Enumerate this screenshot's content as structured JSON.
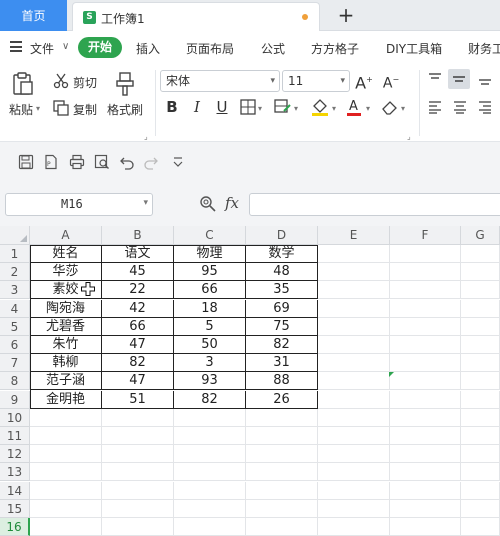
{
  "tabs": {
    "home_label": "首页",
    "doc_label": "工作簿1",
    "doc_icon_letter": "S",
    "add_icon": "plus-icon"
  },
  "menu": {
    "file_label": "文件",
    "items": [
      "开始",
      "插入",
      "页面布局",
      "公式",
      "方方格子",
      "DIY工具箱",
      "财务工"
    ]
  },
  "ribbon": {
    "paste_label": "粘贴",
    "cut_label": "剪切",
    "copy_label": "复制",
    "format_painter_label": "格式刷",
    "font_name": "宋体",
    "font_size": "11"
  },
  "formula_bar": {
    "cell_ref": "M16",
    "fx_label": "fx",
    "formula": ""
  },
  "sheet": {
    "columns": [
      "A",
      "B",
      "C",
      "D",
      "E",
      "F",
      "G"
    ],
    "rows": [
      "1",
      "2",
      "3",
      "4",
      "5",
      "6",
      "7",
      "8",
      "9",
      "10",
      "11",
      "12",
      "13",
      "14",
      "15",
      "16"
    ],
    "active_row": "16",
    "data": [
      [
        "姓名",
        "语文",
        "物理",
        "数学"
      ],
      [
        "华莎",
        "45",
        "95",
        "48"
      ],
      [
        "素姣",
        "22",
        "66",
        "35"
      ],
      [
        "陶宛海",
        "42",
        "18",
        "69"
      ],
      [
        "尤碧香",
        "66",
        "5",
        "75"
      ],
      [
        "朱竹",
        "47",
        "50",
        "82"
      ],
      [
        "韩柳",
        "82",
        "3",
        "31"
      ],
      [
        "范子涵",
        "47",
        "93",
        "88"
      ],
      [
        "金明艳",
        "51",
        "82",
        "26"
      ]
    ]
  },
  "colors": {
    "accent_blue": "#3d8ef0",
    "accent_green": "#2ea44f",
    "modified_dot": "#f0a03a"
  }
}
